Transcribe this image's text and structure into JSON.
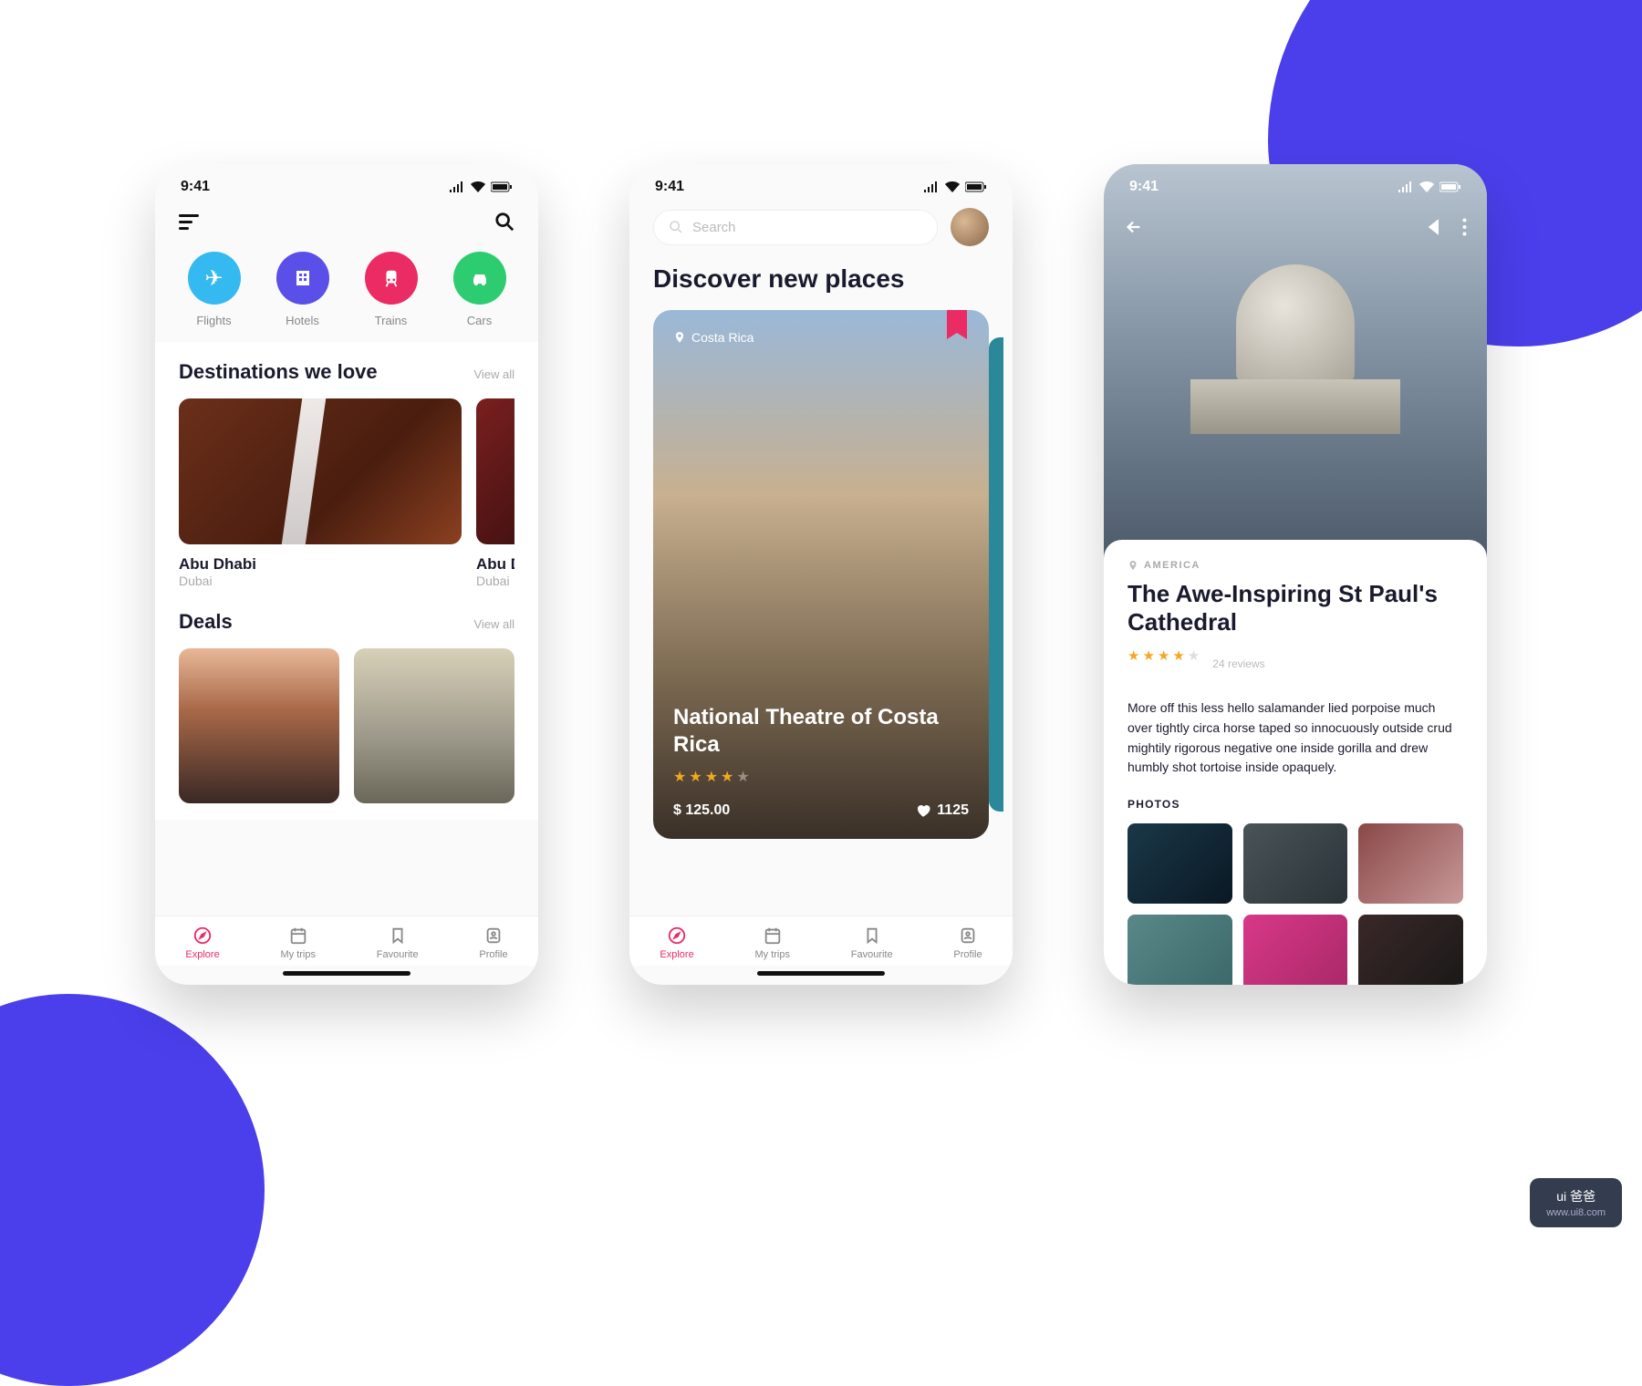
{
  "status": {
    "time": "9:41"
  },
  "screen1": {
    "categories": [
      {
        "label": "Flights"
      },
      {
        "label": "Hotels"
      },
      {
        "label": "Trains"
      },
      {
        "label": "Cars"
      }
    ],
    "destinations": {
      "title": "Destinations we love",
      "view_all": "View all",
      "items": [
        {
          "name": "Abu Dhabi",
          "sub": "Dubai"
        },
        {
          "name": "Abu Dhabi",
          "sub": "Dubai"
        }
      ]
    },
    "deals": {
      "title": "Deals",
      "view_all": "View all"
    }
  },
  "screen2": {
    "search_placeholder": "Search",
    "title": "Discover new places",
    "card": {
      "location": "Costa Rica",
      "title": "National Theatre of Costa Rica",
      "rating": 4,
      "price": "$ 125.00",
      "likes": "1125"
    }
  },
  "screen3": {
    "location": "AMERICA",
    "title": "The Awe-Inspiring St Paul's Cathedral",
    "rating": 4,
    "reviews": "24 reviews",
    "description": "More off this less hello salamander lied porpoise much over tightly circa horse taped so innocuously outside crud mightily rigorous negative one inside gorilla and drew humbly shot tortoise inside opaquely.",
    "photos_label": "PHOTOS"
  },
  "tabs": [
    {
      "label": "Explore"
    },
    {
      "label": "My trips"
    },
    {
      "label": "Favourite"
    },
    {
      "label": "Profile"
    }
  ],
  "watermark": {
    "main": "ui 爸爸",
    "sub": "www.ui8.com"
  }
}
